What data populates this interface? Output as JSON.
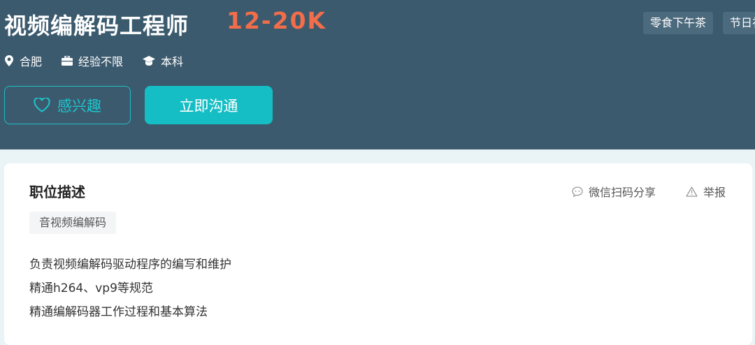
{
  "job": {
    "title": "视频编解码工程师",
    "salary": "12-20K",
    "benefits": [
      "零食下午茶",
      "节日礼"
    ],
    "location": "合肥",
    "experience": "经验不限",
    "education": "本科"
  },
  "actions": {
    "interest_label": "感兴趣",
    "chat_label": "立即沟通"
  },
  "detail": {
    "section_title": "职位描述",
    "share_label": "微信扫码分享",
    "report_label": "举报",
    "skill_tag": "音视频编解码",
    "description": [
      "负责视频编解码驱动程序的编写和维护",
      "精通h264、vp9等规范",
      "精通编解码器工作过程和基本算法"
    ]
  },
  "icons": [
    "location-icon",
    "briefcase-icon",
    "graduation-cap-icon",
    "heart-icon",
    "chat-bubble-icon",
    "warning-icon"
  ],
  "colors": {
    "header_bg": "#3b5a6e",
    "salary": "#f26d4a",
    "accent": "#15bec4",
    "page_bg": "#eaf4f6"
  }
}
